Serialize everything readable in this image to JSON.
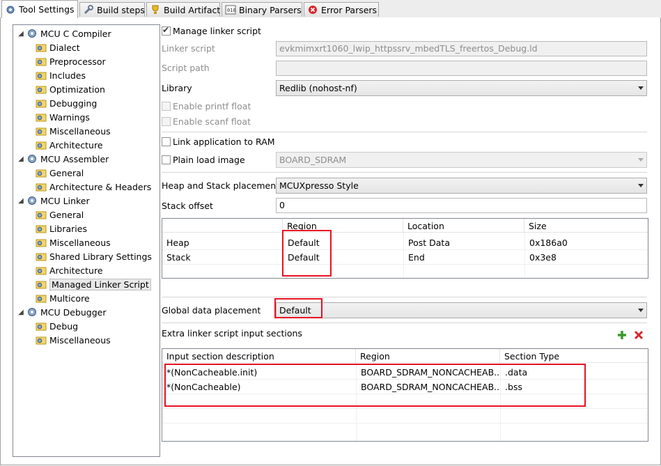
{
  "tabs": [
    {
      "label": "Tool Settings",
      "icon": "gear-icon",
      "active": true
    },
    {
      "label": "Build steps",
      "icon": "wrench-icon"
    },
    {
      "label": "Build Artifact",
      "icon": "trophy-icon"
    },
    {
      "label": "Binary Parsers",
      "icon": "binary-icon"
    },
    {
      "label": "Error Parsers",
      "icon": "error-icon"
    }
  ],
  "tree": {
    "groups": [
      {
        "label": "MCU C Compiler",
        "items": [
          "Dialect",
          "Preprocessor",
          "Includes",
          "Optimization",
          "Debugging",
          "Warnings",
          "Miscellaneous",
          "Architecture"
        ]
      },
      {
        "label": "MCU Assembler",
        "items": [
          "General",
          "Architecture & Headers"
        ]
      },
      {
        "label": "MCU Linker",
        "items": [
          "General",
          "Libraries",
          "Miscellaneous",
          "Shared Library Settings",
          "Architecture",
          "Managed Linker Script",
          "Multicore"
        ]
      },
      {
        "label": "MCU Debugger",
        "items": [
          "Debug",
          "Miscellaneous"
        ]
      }
    ],
    "selected": "Managed Linker Script"
  },
  "form": {
    "manage_linker_script": "Manage linker script",
    "linker_script_label": "Linker script",
    "linker_script_value": "evkmimxrt1060_lwip_httpssrv_mbedTLS_freertos_Debug.ld",
    "script_path_label": "Script path",
    "script_path_value": "",
    "library_label": "Library",
    "library_value": "Redlib (nohost-nf)",
    "printf_float": "Enable printf float",
    "scanf_float": "Enable scanf float",
    "link_to_ram": "Link application to RAM",
    "plain_load": "Plain load image",
    "plain_load_value": "BOARD_SDRAM",
    "heap_stack_label": "Heap and Stack placement",
    "heap_stack_value": "MCUXpresso Style",
    "stack_offset_label": "Stack offset",
    "stack_offset_value": "0",
    "global_data_label": "Global data placement",
    "global_data_value": "Default",
    "extra_sections_label": "Extra linker script input sections"
  },
  "heap_table": {
    "headers": [
      "",
      "Region",
      "Location",
      "Size"
    ],
    "rows": [
      [
        "Heap",
        "Default",
        "Post Data",
        "0x186a0"
      ],
      [
        "Stack",
        "Default",
        "End",
        "0x3e8"
      ]
    ]
  },
  "sections_table": {
    "headers": [
      "Input section description",
      "Region",
      "Section Type"
    ],
    "rows": [
      [
        "*(NonCacheable.init)",
        "BOARD_SDRAM_NONCACHEAB...",
        ".data"
      ],
      [
        "*(NonCacheable)",
        "BOARD_SDRAM_NONCACHEAB...",
        ".bss"
      ]
    ]
  },
  "colors": {
    "highlight": "#e81123",
    "add": "#3a9a2a",
    "remove": "#d9262b"
  }
}
